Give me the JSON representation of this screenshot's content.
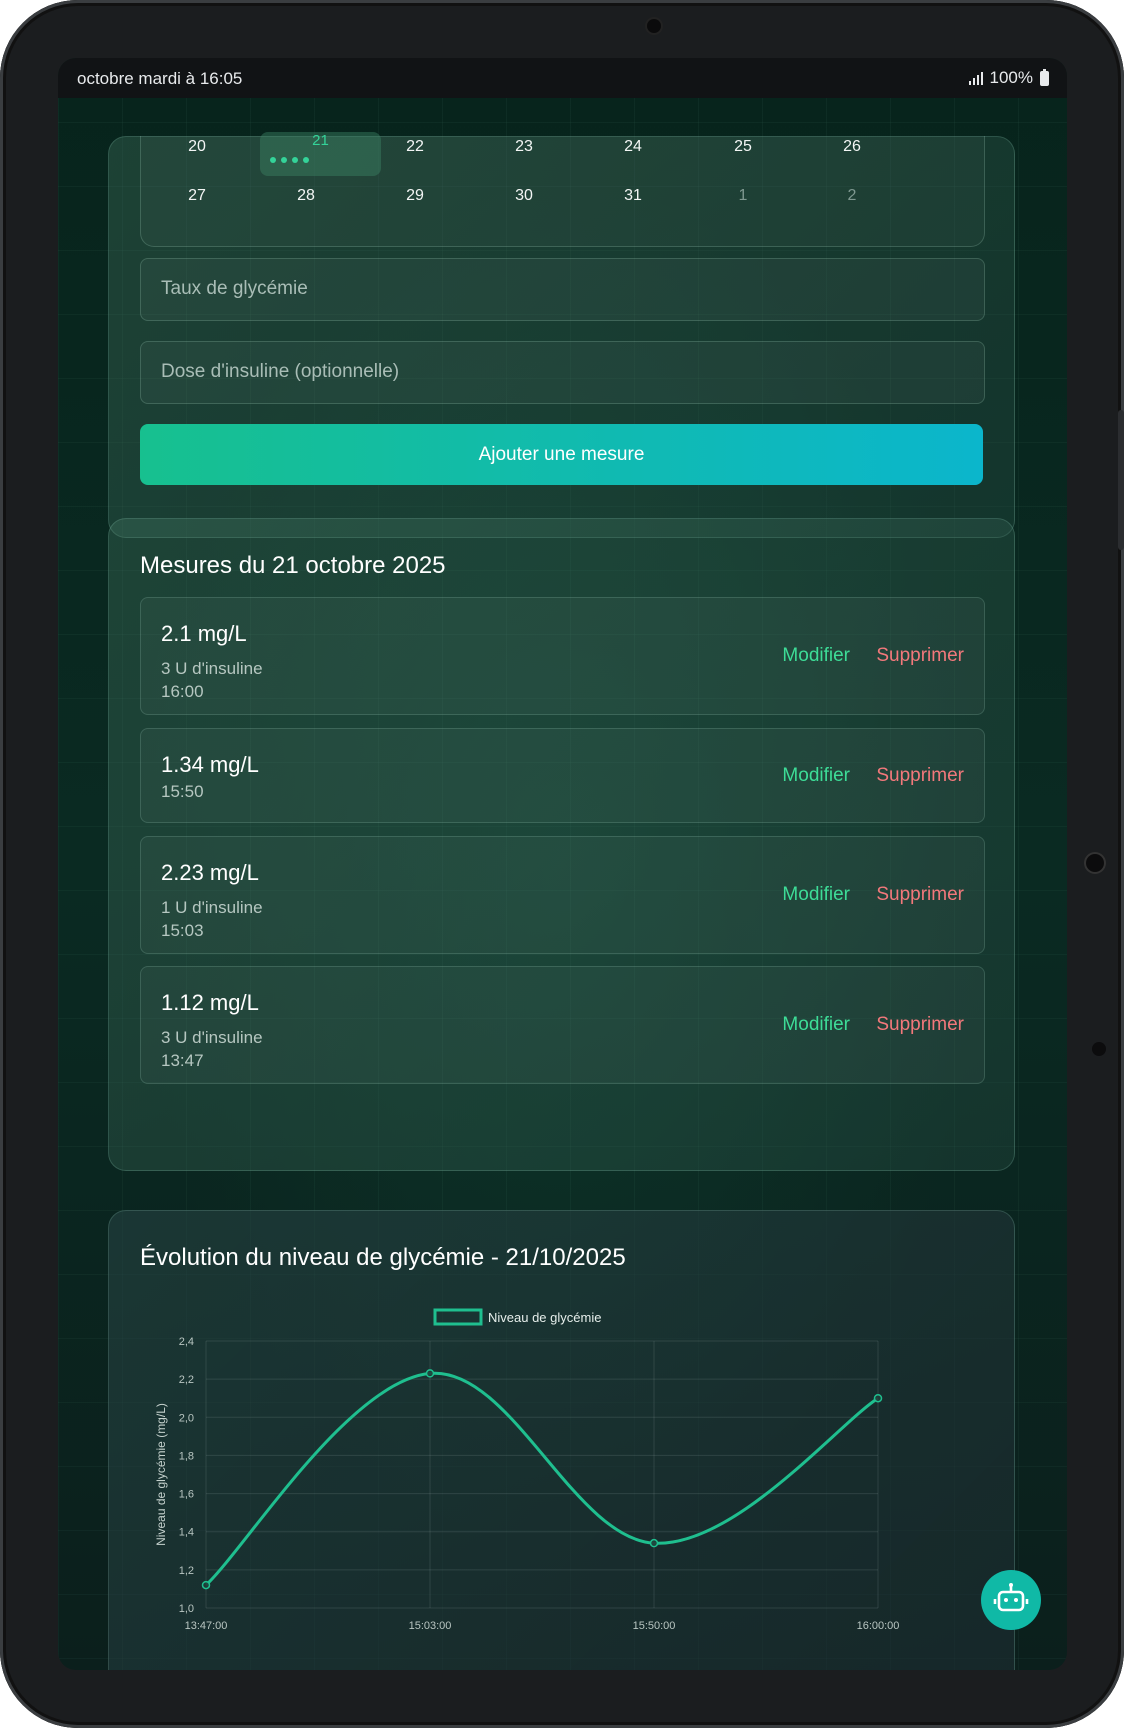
{
  "statusbar": {
    "time": "octobre mardi à 16:05",
    "battery": "100%"
  },
  "calendar": {
    "row1": [
      "20",
      "21",
      "22",
      "23",
      "24",
      "25",
      "26"
    ],
    "row2": [
      "27",
      "28",
      "29",
      "30",
      "31",
      "1",
      "2"
    ],
    "selected": "21"
  },
  "form": {
    "glucose_placeholder": "Taux de glycémie",
    "insulin_placeholder": "Dose d'insuline (optionnelle)",
    "add_button": "Ajouter une mesure"
  },
  "measures": {
    "title": "Mesures du 21 octobre 2025",
    "edit_label": "Modifier",
    "delete_label": "Supprimer",
    "items": [
      {
        "value": "2.1 mg/L",
        "insulin": "3 U d'insuline",
        "time": "16:00"
      },
      {
        "value": "1.34 mg/L",
        "insulin": "",
        "time": "15:50"
      },
      {
        "value": "2.23 mg/L",
        "insulin": "1 U d'insuline",
        "time": "15:03"
      },
      {
        "value": "1.12 mg/L",
        "insulin": "3 U d'insuline",
        "time": "13:47"
      }
    ]
  },
  "chart_section": {
    "title": "Évolution du niveau de glycémie - 21/10/2025"
  },
  "chart_data": {
    "type": "line",
    "categories": [
      "13:47:00",
      "15:03:00",
      "15:50:00",
      "16:00:00"
    ],
    "series": [
      {
        "name": "Niveau de glycémie",
        "values": [
          1.12,
          2.23,
          1.34,
          2.1
        ]
      }
    ],
    "ylabel": "Niveau de glycémie (mg/L)",
    "ylim": [
      1.0,
      2.4
    ],
    "yticks": [
      "1,0",
      "1,2",
      "1,4",
      "1,6",
      "1,8",
      "2,0",
      "2,2",
      "2,4"
    ],
    "legend": "top",
    "grid": true,
    "color": "#1fbf8f"
  },
  "colors": {
    "accent": "#34d399",
    "delete": "#f2787b",
    "fab": "#10b9a6"
  },
  "fab": {
    "icon": "robot-icon"
  }
}
